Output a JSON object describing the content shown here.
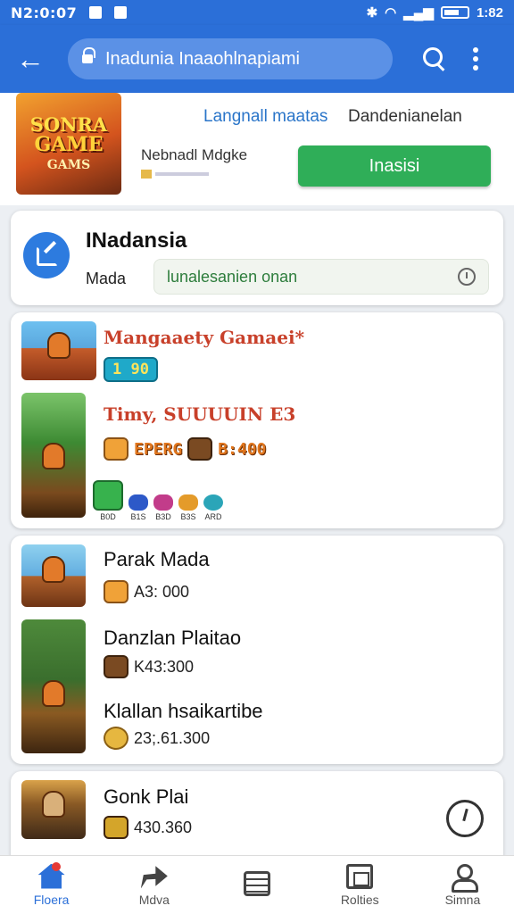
{
  "status_bar": {
    "time": "N2:0:07",
    "battery_text": "1:82"
  },
  "app_bar": {
    "url_text": "Inadunia Inaaohlnapiami"
  },
  "promo": {
    "thumb_line1": "SONRA",
    "thumb_line2": "GAME",
    "thumb_line3": "GAMS",
    "link_text": "Langnall maatas",
    "right_text": "Dandenianelan",
    "subtitle": "Nebnadl Mdgke",
    "install_label": "Inasisi"
  },
  "info_card": {
    "title": "INadansia",
    "label": "Mada",
    "field_value": "lunalesanien onan"
  },
  "list1": {
    "item1": {
      "title": "Mangaaety Gamaei*",
      "pill": "1 90"
    },
    "item2": {
      "title": "Timy, SUUUUIN E3",
      "badge_text": "EPERG",
      "value": "B:400",
      "icon_labels": [
        "B0D",
        "B1S",
        "B3D",
        "B3S",
        "ARD"
      ]
    }
  },
  "list2": {
    "item1": {
      "title": "Parak Mada",
      "value": "A3: 000"
    },
    "item2": {
      "title": "Danzlan Plaitao",
      "value": "K43:300"
    },
    "item3": {
      "title": "Klallan hsaikartibe",
      "value": "23;.61.300"
    }
  },
  "bottom_card": {
    "title": "Gonk Plai",
    "value": "430.360"
  },
  "bottom_nav": [
    {
      "label": "Floera"
    },
    {
      "label": "Mdva"
    },
    {
      "label": ""
    },
    {
      "label": "Rolties"
    },
    {
      "label": "Simna"
    }
  ],
  "colors": {
    "primary": "#2b6fd8",
    "install_green": "#2fae58",
    "link_blue": "#2a75c9"
  }
}
